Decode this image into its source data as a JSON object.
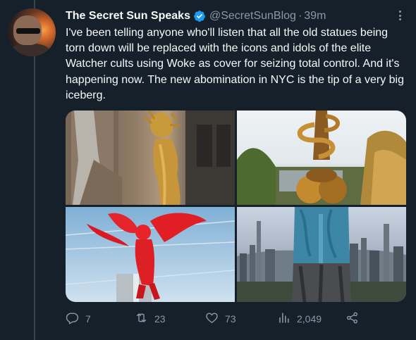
{
  "tweet": {
    "author": {
      "display_name": "The Secret Sun Speaks",
      "handle": "@SecretSunBlog",
      "verified": true,
      "avatar_icon": "profile-photo"
    },
    "separator": "·",
    "time": "39m",
    "text": "I've been telling anyone who'll listen that all the old statues being torn down will be replaced with the icons and idols of the elite Watcher cults using Woke as cover for seizing total control. And it's happening now. The new abomination in NYC is the tip of a very big iceberg.",
    "media": [
      {
        "depicts": "golden female statue on building ledge"
      },
      {
        "depicts": "golden statue with snakes on spheres"
      },
      {
        "depicts": "red winged figure sculpture"
      },
      {
        "depicts": "blue statue before NYC skyline"
      }
    ],
    "actions": {
      "reply_count": "7",
      "retweet_count": "23",
      "like_count": "73",
      "views_count": "2,049"
    }
  },
  "colors": {
    "background": "#15202b",
    "text": "#f7f9f9",
    "muted": "#8b98a5",
    "verified": "#1d9bf0",
    "thread_line": "#38444d"
  }
}
